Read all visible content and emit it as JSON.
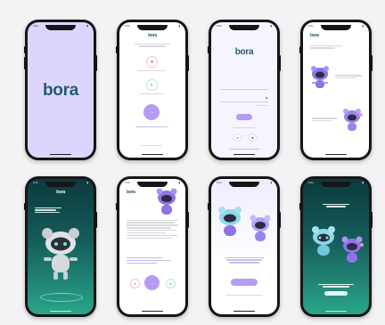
{
  "canvas": {
    "background": "#f3f3f5"
  },
  "colors": {
    "brand": "#295a6a",
    "accent_purple": "#b59cf2",
    "lavender": "#dcd6ff",
    "teal_dark": "#0c3a3e",
    "teal_light": "#2aa58a"
  },
  "phones": [
    {
      "id": "splash",
      "logo": "bora",
      "status_time": "9:41"
    },
    {
      "id": "choose-login",
      "header_logo": "bora",
      "options": [
        "",
        ""
      ],
      "primary_button": "",
      "footer_link": "",
      "status_time": "9:41"
    },
    {
      "id": "login-form",
      "logo": "bora",
      "field_1_placeholder": "",
      "field_2_placeholder": "",
      "primary_button": "",
      "social_icons": [
        "google-icon",
        "apple-icon"
      ],
      "footer_link": "",
      "status_time": "9:41"
    },
    {
      "id": "profile-choice",
      "header_logo": "bora",
      "card_1_title": "",
      "card_2_title": "",
      "status_time": "9:41"
    },
    {
      "id": "profile-generated",
      "header_logo": "bora",
      "headline": "",
      "status_time": "9:41"
    },
    {
      "id": "profile-details",
      "header_logo": "bora",
      "section_title": "",
      "primary_button": "",
      "status_time": "9:41"
    },
    {
      "id": "match-intro",
      "headline": "",
      "primary_button": "",
      "status_time": "9:41"
    },
    {
      "id": "match-found",
      "headline": "",
      "primary_button": "",
      "status_time": "9:41"
    }
  ]
}
